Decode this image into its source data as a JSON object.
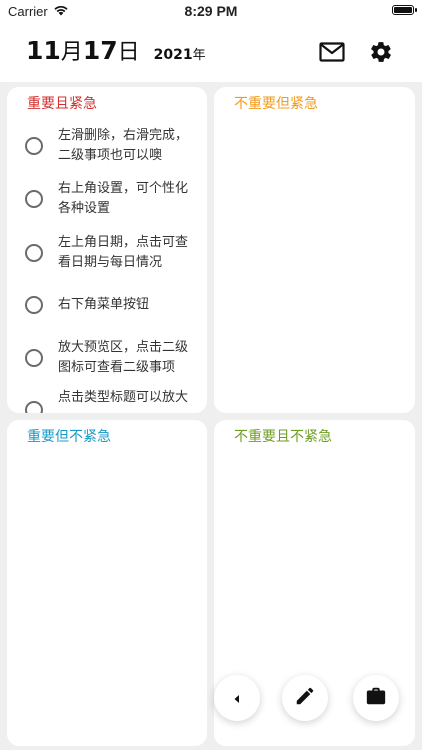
{
  "status_bar": {
    "carrier": "Carrier",
    "time": "8:29 PM",
    "battery_level": 100
  },
  "header": {
    "month": "11",
    "month_char": "月",
    "day": "17",
    "day_char": "日",
    "year": "2021",
    "year_char": "年",
    "icons": [
      "mail-icon",
      "gear-icon"
    ]
  },
  "quadrants": [
    {
      "title": "重要且紧急",
      "color": "#d32f2f",
      "tasks": [
        "左滑删除，右滑完成，二级事项也可以噢",
        "右上角设置，可个性化各种设置",
        "左上角日期，点击可查看日期与每日情况",
        "右下角菜单按钮",
        "放大预览区，点击二级图标可查看二级事项",
        "点击类型标题可以放大"
      ]
    },
    {
      "title": "不重要但紧急",
      "color": "#f29a1d",
      "tasks": []
    },
    {
      "title": "重要但不紧急",
      "color": "#1a9bc7",
      "tasks": []
    },
    {
      "title": "不重要且不紧急",
      "color": "#6e9e22",
      "tasks": []
    }
  ],
  "fab_icons": [
    "chevron-left-icon",
    "pencil-icon",
    "briefcase-icon"
  ]
}
